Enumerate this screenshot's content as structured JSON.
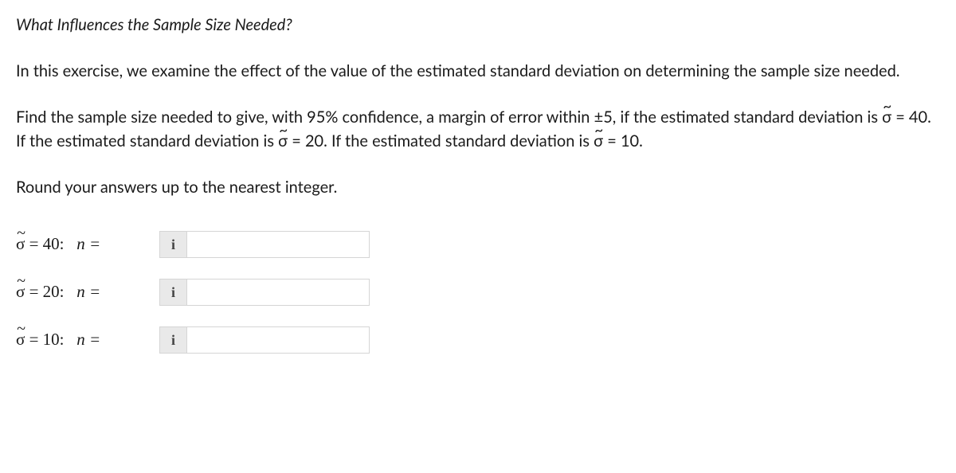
{
  "heading": "What Influences the Sample Size Needed?",
  "intro": "In this exercise, we examine the effect of the value of the estimated standard deviation on determining the sample size needed.",
  "prompt": {
    "pre": "Find the sample size needed to give, with 95% confidence, a margin of error within ",
    "pm": "±5",
    "mid1": ", if the estimated standard deviation is ",
    "sig1_lhs": "σ",
    "sig1_eq": " = 40",
    "mid2": ". If the estimated standard deviation is ",
    "sig2_lhs": "σ",
    "sig2_eq": " = 20",
    "mid3": ". If the estimated standard deviation is ",
    "sig3_lhs": "σ",
    "sig3_eq": " = 10",
    "end": "."
  },
  "rounding": "Round your answers up to the nearest integer.",
  "rows": [
    {
      "sigma": "40",
      "value": ""
    },
    {
      "sigma": "20",
      "value": ""
    },
    {
      "sigma": "10",
      "value": ""
    }
  ],
  "labels": {
    "n_equals": "n =",
    "colon": ":",
    "equals": "=",
    "info": "i"
  }
}
